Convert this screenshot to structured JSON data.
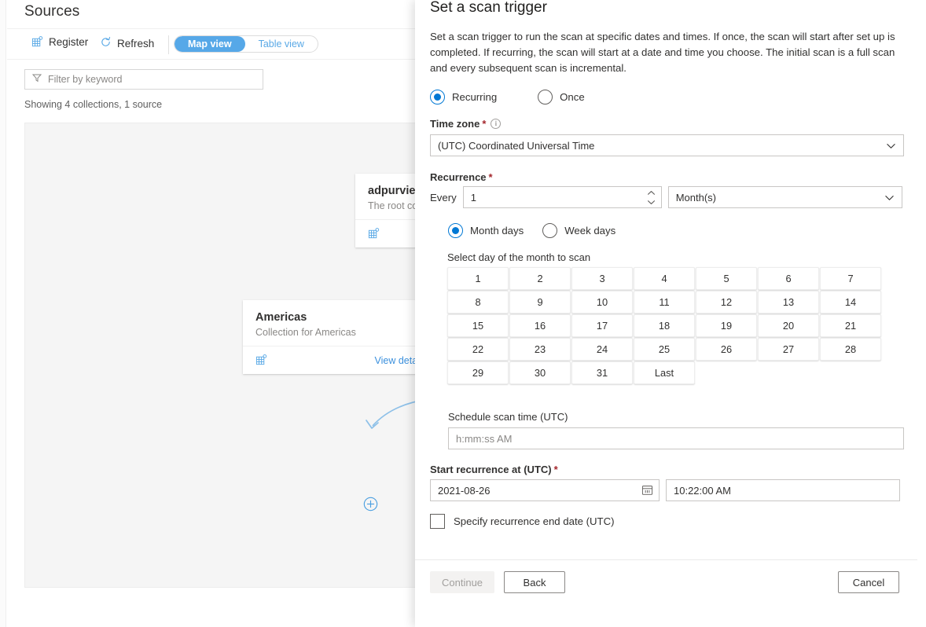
{
  "background_app": {
    "page_title": "Sources",
    "commands": [
      {
        "label": "Register",
        "icon": "grid-plus-icon"
      },
      {
        "label": "Refresh",
        "icon": "refresh-icon"
      }
    ],
    "view_toggle": {
      "active": "Map view",
      "inactive": "Table view"
    },
    "filter": {
      "placeholder": "Filter by keyword",
      "icon": "filter-icon"
    },
    "status_text": "Showing 4 collections, 1 source",
    "cards": [
      {
        "title": "adpurview",
        "subtitle": "The root collection",
        "icon": "grid-plus-icon",
        "link": ""
      },
      {
        "title": "Americas",
        "subtitle": "Collection for Americas",
        "icon": "grid-plus-icon",
        "link": "View details"
      }
    ],
    "add_node_icon": "plus-circle-icon",
    "colors": {
      "accent": "#56a8e8",
      "link": "#3b90dd",
      "canvas": "#f5f5f5"
    }
  },
  "panel": {
    "title": "Set a scan trigger",
    "description": "Set a scan trigger to run the scan at specific dates and times. If once, the scan will start after set up is completed. If recurring, the scan will start at a date and time you choose. The initial scan is a full scan and every subsequent scan is incremental.",
    "trigger_type": {
      "options": [
        {
          "label": "Recurring",
          "selected": true
        },
        {
          "label": "Once",
          "selected": false
        }
      ]
    },
    "timezone": {
      "label": "Time zone",
      "required_marker": "*",
      "info_icon": "info-icon",
      "value": "(UTC) Coordinated Universal Time",
      "chevron_icon": "chevron-down-icon"
    },
    "recurrence": {
      "label": "Recurrence",
      "required_marker": "*",
      "every_label": "Every",
      "every_value": "1",
      "spinner_icon": "spinner-up-down-icon",
      "unit_value": "Month(s)",
      "unit_chevron_icon": "chevron-down-icon",
      "day_type": {
        "options": [
          {
            "label": "Month days",
            "selected": true
          },
          {
            "label": "Week days",
            "selected": false
          }
        ]
      },
      "select_day_label": "Select day of the month to scan",
      "days": [
        "1",
        "2",
        "3",
        "4",
        "5",
        "6",
        "7",
        "8",
        "9",
        "10",
        "11",
        "12",
        "13",
        "14",
        "15",
        "16",
        "17",
        "18",
        "19",
        "20",
        "21",
        "22",
        "23",
        "24",
        "25",
        "26",
        "27",
        "28",
        "29",
        "30",
        "31",
        "Last"
      ]
    },
    "scan_time": {
      "label": "Schedule scan time (UTC)",
      "placeholder": "h:mm:ss AM",
      "value": ""
    },
    "start_recurrence": {
      "label": "Start recurrence at (UTC)",
      "required_marker": "*",
      "date_value": "2021-08-26",
      "calendar_icon": "calendar-icon",
      "time_value": "10:22:00 AM"
    },
    "end_date_checkbox": {
      "label": "Specify recurrence end date (UTC)",
      "checked": false
    },
    "footer": {
      "continue_label": "Continue",
      "continue_disabled": true,
      "back_label": "Back",
      "cancel_label": "Cancel"
    },
    "colors": {
      "accent": "#0078d4",
      "required": "#a4262c",
      "border": "#c8c6c4"
    }
  }
}
